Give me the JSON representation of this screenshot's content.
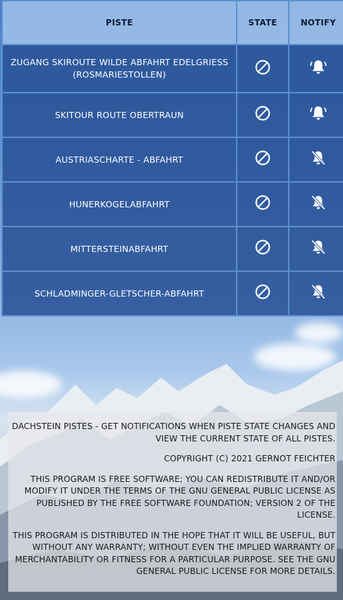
{
  "table": {
    "headers": {
      "piste": "PISTE",
      "state": "STATE",
      "notify": "NOTIFY"
    },
    "rows": [
      {
        "piste": "ZUGANG SKIROUTE WILDE ABFAHRT EDELGRIESS (ROSMARIESTOLLEN)",
        "state_icon": "closed-icon",
        "notify_icon": "bell-on-icon"
      },
      {
        "piste": "SKITOUR ROUTE OBERTRAUN",
        "state_icon": "closed-icon",
        "notify_icon": "bell-on-icon"
      },
      {
        "piste": "AUSTRIASCHARTE - ABFAHRT",
        "state_icon": "closed-icon",
        "notify_icon": "bell-off-icon"
      },
      {
        "piste": "HUNERKOGELABFAHRT",
        "state_icon": "closed-icon",
        "notify_icon": "bell-off-icon"
      },
      {
        "piste": "MITTERSTEINABFAHRT",
        "state_icon": "closed-icon",
        "notify_icon": "bell-off-icon"
      },
      {
        "piste": "SCHLADMINGER-GLETSCHER-ABFAHRT",
        "state_icon": "closed-icon",
        "notify_icon": "bell-off-icon"
      }
    ]
  },
  "footer": {
    "p1": "DACHSTEIN PISTES - GET NOTIFICATIONS WHEN PISTE STATE CHANGES AND VIEW THE CURRENT STATE OF ALL PISTES.",
    "p2": "COPYRIGHT (C) 2021 GERNOT FEICHTER",
    "p3": "THIS PROGRAM IS FREE SOFTWARE; YOU CAN REDISTRIBUTE IT AND/OR MODIFY IT UNDER THE TERMS OF THE GNU GENERAL PUBLIC LICENSE AS PUBLISHED BY THE FREE SOFTWARE FOUNDATION; VERSION 2 OF THE LICENSE.",
    "p4": "THIS PROGRAM IS DISTRIBUTED IN THE HOPE THAT IT WILL BE USEFUL, BUT WITHOUT ANY WARRANTY; WITHOUT EVEN THE IMPLIED WARRANTY OF MERCHANTABILITY OR FITNESS FOR A PARTICULAR PURPOSE. SEE THE GNU GENERAL PUBLIC LICENSE FOR MORE DETAILS."
  },
  "colors": {
    "header_bg": "#a3c4ec",
    "row_bg": "#295296",
    "border": "#5b8fd0",
    "footer_bg": "#e8e8ec"
  }
}
